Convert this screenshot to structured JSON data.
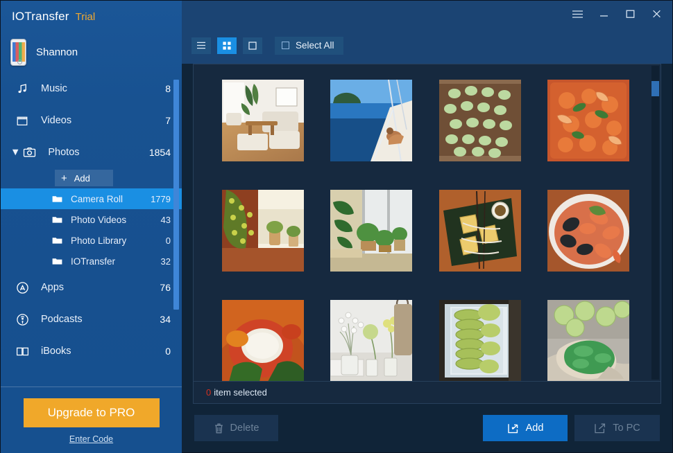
{
  "app": {
    "brand": "IOTransfer",
    "edition": "Trial",
    "accent_orange": "#f0a82a",
    "accent_blue": "#1a8fe3",
    "sidebar_blue": "#185291",
    "status_red": "#d5301f"
  },
  "titlebar": {
    "menu_label": "",
    "minimize_label": "",
    "maximize_label": "",
    "close_label": ""
  },
  "device": {
    "name": "Shannon",
    "icon": "iphone-icon"
  },
  "sidebar": {
    "items": [
      {
        "label": "Music",
        "count": "8",
        "icon": "music-note-icon",
        "type": "top"
      },
      {
        "label": "Videos",
        "count": "7",
        "icon": "film-icon",
        "type": "top"
      },
      {
        "label": "Photos",
        "count": "1854",
        "icon": "camera-icon",
        "type": "top",
        "expanded": true
      }
    ],
    "photos_children": {
      "add_label": "Add",
      "folders": [
        {
          "label": "Camera Roll",
          "count": "1779",
          "active": true
        },
        {
          "label": "Photo Videos",
          "count": "43",
          "active": false
        },
        {
          "label": "Photo Library",
          "count": "0",
          "active": false
        },
        {
          "label": "IOTransfer",
          "count": "32",
          "active": false
        }
      ]
    },
    "items_after": [
      {
        "label": "Apps",
        "count": "76",
        "icon": "appstore-icon",
        "type": "top"
      },
      {
        "label": "Podcasts",
        "count": "34",
        "icon": "podcast-icon",
        "type": "top"
      },
      {
        "label": "iBooks",
        "count": "0",
        "icon": "books-icon",
        "type": "top"
      }
    ],
    "promo": {
      "upgrade_label": "Upgrade to PRO",
      "enter_code_label": "Enter Code"
    }
  },
  "toolbar": {
    "views": [
      {
        "name": "list-view",
        "active": false
      },
      {
        "name": "grid-view",
        "active": true
      },
      {
        "name": "large-view",
        "active": false
      }
    ],
    "select_all_label": "Select All",
    "select_all_checked": false
  },
  "content": {
    "status_count": "0",
    "status_text": "item selected",
    "photos": [
      {
        "alt": "living-room-sofa-plants"
      },
      {
        "alt": "sailboat-blue-sea"
      },
      {
        "alt": "green-macarons-on-board"
      },
      {
        "alt": "seafood-paella-shrimp"
      },
      {
        "alt": "christmas-tree-window"
      },
      {
        "alt": "indoor-plants-window"
      },
      {
        "alt": "cheese-slices-green-board"
      },
      {
        "alt": "seafood-mussels-bowl"
      },
      {
        "alt": "stuffed-red-pepper-rice"
      },
      {
        "alt": "white-flowers-glass-vases"
      },
      {
        "alt": "green-macarons-in-box"
      },
      {
        "alt": "hand-holding-green-bread"
      }
    ]
  },
  "footer": {
    "delete_label": "Delete",
    "add_label": "Add",
    "to_pc_label": "To PC"
  }
}
